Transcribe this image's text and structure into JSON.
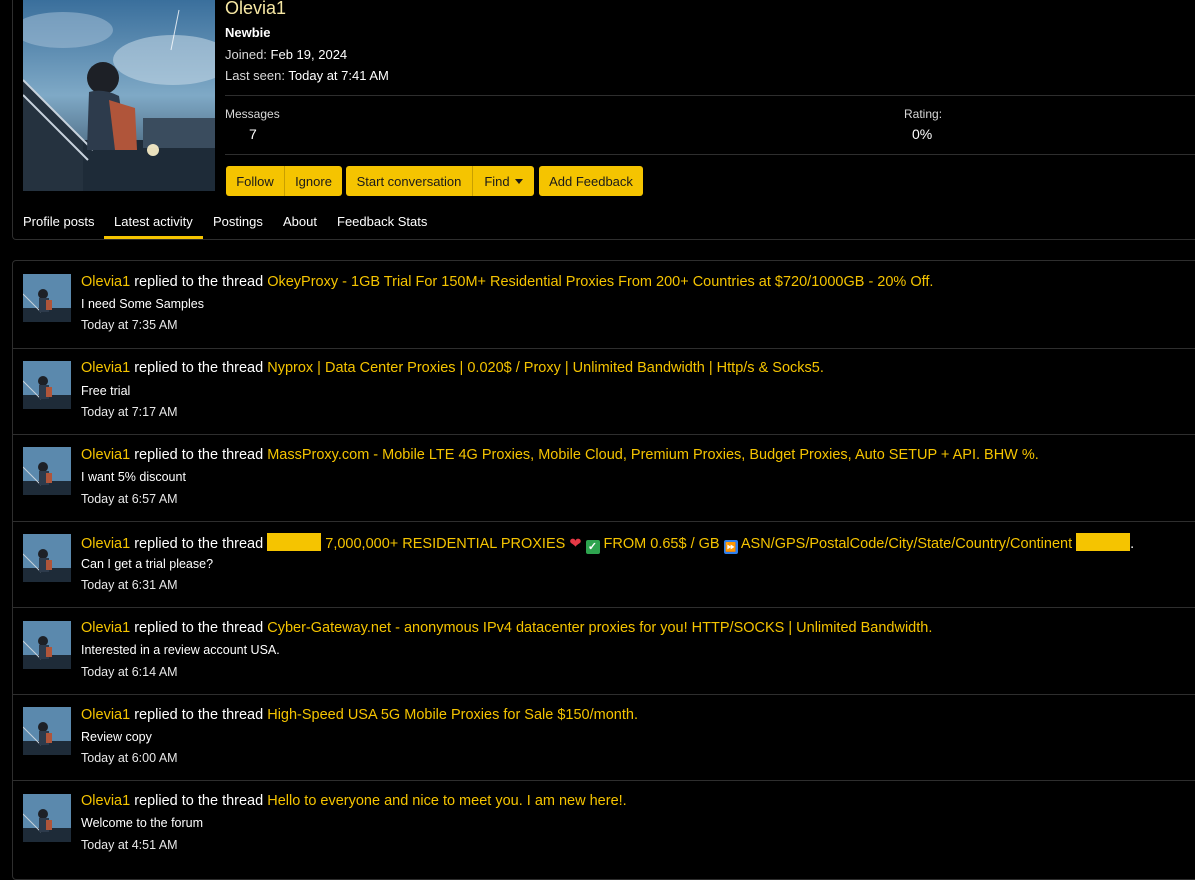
{
  "profile": {
    "username": "Olevia1",
    "user_title": "Newbie",
    "joined_label": "Joined:",
    "joined_value": "Feb 19, 2024",
    "last_seen_label": "Last seen:",
    "last_seen_value": "Today at 7:41 AM",
    "messages_label": "Messages",
    "messages_value": "7",
    "rating_label": "Rating:",
    "rating_value": "0%"
  },
  "actions": {
    "follow": "Follow",
    "ignore": "Ignore",
    "start_conversation": "Start conversation",
    "find": "Find",
    "add_feedback": "Add Feedback"
  },
  "tabs": [
    "Profile posts",
    "Latest activity",
    "Postings",
    "About",
    "Feedback Stats"
  ],
  "active_tab": "Latest activity",
  "accent_color": "#f5c400",
  "activity": [
    {
      "user": "Olevia1",
      "verb": "replied to the thread",
      "thread": "OkeyProxy - 1GB Trial For 150M+ Residential Proxies From 200+ Countries at $720/1000GB - 20% Off.",
      "snippet": "I need Some Samples",
      "time": "Today at 7:35 AM"
    },
    {
      "user": "Olevia1",
      "verb": "replied to the thread",
      "thread": "Nyprox | Data Center Proxies | 0.020$ / Proxy | Unlimited Bandwidth | Http/s & Socks5.",
      "snippet": "Free trial",
      "time": "Today at 7:17 AM"
    },
    {
      "user": "Olevia1",
      "verb": "replied to the thread",
      "thread": "MassProxy.com - Mobile LTE 4G Proxies, Mobile Cloud, Premium Proxies, Budget Proxies, Auto SETUP + API. BHW %.",
      "snippet": "I want 5% discount",
      "time": "Today at 6:57 AM"
    },
    {
      "user": "Olevia1",
      "verb": "replied to the thread",
      "thread_part1": "7,000,000+ RESIDENTIAL PROXIES",
      "emoji_heart": "❤",
      "emoji_check": "✓",
      "thread_part2": "FROM 0.65$ / GB",
      "emoji_ff": "⏩",
      "thread_part3": "ASN/GPS/PostalCode/City/State/Country/Continent",
      "thread_end": ".",
      "snippet": "Can I get a trial please?",
      "time": "Today at 6:31 AM"
    },
    {
      "user": "Olevia1",
      "verb": "replied to the thread",
      "thread": "Cyber-Gateway.net - anonymous IPv4 datacenter proxies for you! HTTP/SOCKS | Unlimited Bandwidth.",
      "snippet": "Interested in a review account USA.",
      "time": "Today at 6:14 AM"
    },
    {
      "user": "Olevia1",
      "verb": "replied to the thread",
      "thread": "High-Speed USA 5G Mobile Proxies for Sale $150/month.",
      "snippet": "Review copy",
      "time": "Today at 6:00 AM"
    },
    {
      "user": "Olevia1",
      "verb": "replied to the thread",
      "thread": "Hello to everyone and nice to meet you. I am new here!.",
      "snippet": "Welcome to the forum",
      "time": "Today at 4:51 AM"
    }
  ]
}
